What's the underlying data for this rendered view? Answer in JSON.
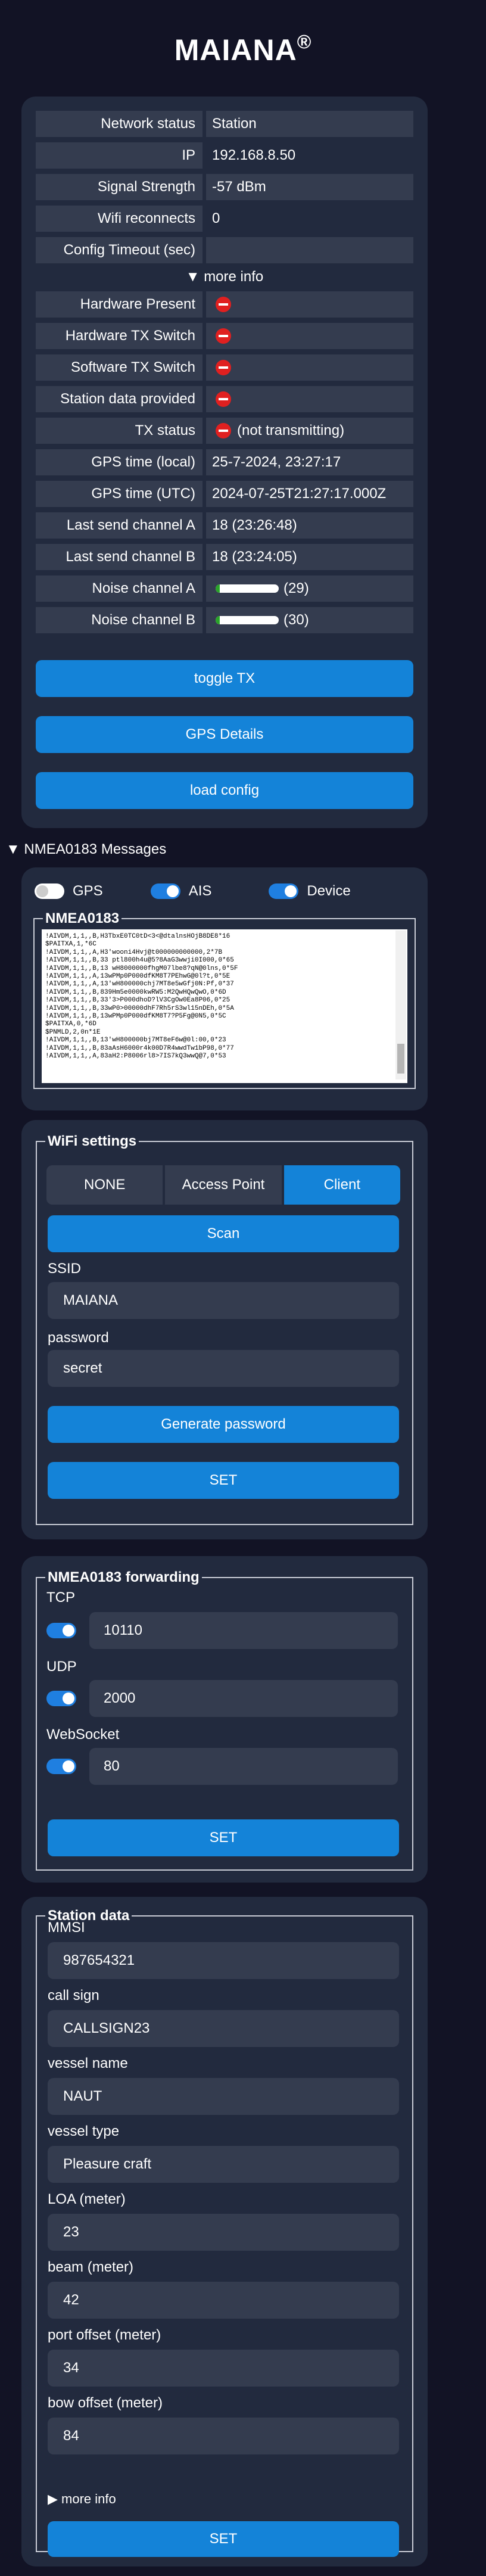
{
  "app": {
    "title": "MAIANA",
    "registered": "®"
  },
  "status": {
    "rows": [
      {
        "label": "Network status",
        "value": "Station",
        "type": "text"
      },
      {
        "label": "IP",
        "value": "192.168.8.50",
        "type": "text",
        "plain": true
      },
      {
        "label": "Signal Strength",
        "value": "-57 dBm",
        "type": "text"
      },
      {
        "label": "Wifi reconnects",
        "value": "0",
        "type": "text",
        "plain": true
      },
      {
        "label": "Config Timeout (sec)",
        "value": "",
        "type": "text"
      }
    ],
    "more_info": "▼ more info",
    "rows2": [
      {
        "label": "Hardware Present",
        "value": "",
        "type": "dot"
      },
      {
        "label": "Hardware TX Switch",
        "value": "",
        "type": "dot"
      },
      {
        "label": "Software TX Switch",
        "value": "",
        "type": "dot"
      },
      {
        "label": "Station data provided",
        "value": "",
        "type": "dot"
      },
      {
        "label": "TX status",
        "value": "(not transmitting)",
        "type": "dot"
      },
      {
        "label": "GPS time (local)",
        "value": "25-7-2024, 23:27:17",
        "type": "text"
      },
      {
        "label": "GPS time (UTC)",
        "value": "2024-07-25T21:27:17.000Z",
        "type": "text"
      },
      {
        "label": "Last send channel A",
        "value": "18 (23:26:48)",
        "type": "text"
      },
      {
        "label": "Last send channel B",
        "value": "18 (23:24:05)",
        "type": "text"
      },
      {
        "label": "Noise channel A",
        "value": "(29)",
        "type": "meter",
        "level": 0.07
      },
      {
        "label": "Noise channel B",
        "value": "(30)",
        "type": "meter",
        "level": 0.07
      }
    ],
    "buttons": {
      "toggle_tx": "toggle TX",
      "gps_details": "GPS Details",
      "load_config": "load config"
    }
  },
  "nmea": {
    "section_label": "▼ NMEA0183 Messages",
    "toggles": [
      {
        "label": "GPS",
        "on": false
      },
      {
        "label": "AIS",
        "on": true
      },
      {
        "label": "Device",
        "on": true
      }
    ],
    "legend": "NMEA0183",
    "lines": [
      "!AIVDM,1,1,,B,H3TbxE0TC0tD<3<@dtalnsHOjB8DE8*16",
      "$PAITXA,1,*6C",
      "!AIVDM,1,1,,A,H3'wooni4Hvj@t000000000000,2*7B",
      "!AIVDM,1,1,,B,33 ptl800h4u@5?8AaG3wwji0I000,0*65",
      "!AIVDM,1,1,,B,13 wH8000000fhgM07lbe8?qN@0lns,0*5F",
      "!AIVDM,1,1,,A,13wPMp0P000dfKM8T7PEhwG@0l?t,0*5E",
      "!AIVDM,1,1,,A,13'wH800000chj7MT8e5wGfj0N:Pf,0*37",
      "!AIVDM,1,1,,B,839Hm5e0000kwRW5:M2QwHQwQwO,0*6D",
      "!AIVDM,1,1,,B,33'3>P000dhoD?lV3CgOw0Ea8P06,0*25",
      "!AIVDM,1,1,,B,33wP0>00000dhF7Rh5rS3wl15nDEh,0*5A",
      "!AIVDM,1,1,,B,13wPMp0P000dfKM8T7?P5Fg@0N5,0*5C",
      "$PAITXA,0,*6D",
      "$PNMLD,2,0n*1E",
      "!AIVDM,1,1,,B,13'wH800000bj7MT8eF6w@0l:00,0*23",
      "!AIVDM,1,1,,B,83aAsH6000r4k00D7R4wwdTw1bP98,0*77",
      "!AIVDM,1,1,,A,83aH2:P8006rl8>7IS7kQ3wwQ@7,0*53"
    ]
  },
  "wifi": {
    "legend": "WiFi settings",
    "modes": [
      "NONE",
      "Access Point",
      "Client"
    ],
    "active_mode": "Client",
    "scan_label": "Scan",
    "ssid_label": "SSID",
    "ssid_value": "MAIANA",
    "password_label": "password",
    "password_value": "secret",
    "generate_label": "Generate password",
    "set_label": "SET"
  },
  "forwarding": {
    "legend": "NMEA0183 forwarding",
    "items": [
      {
        "label": "TCP",
        "on": true,
        "value": "10110"
      },
      {
        "label": "UDP",
        "on": true,
        "value": "2000"
      },
      {
        "label": "WebSocket",
        "on": true,
        "value": "80"
      }
    ],
    "set_label": "SET"
  },
  "station": {
    "legend": "Station data",
    "fields": [
      {
        "label": "MMSI",
        "value": "987654321"
      },
      {
        "label": "call sign",
        "value": "CALLSIGN23"
      },
      {
        "label": "vessel name",
        "value": "NAUT"
      },
      {
        "label": "vessel type",
        "value": "Pleasure craft"
      },
      {
        "label": "LOA (meter)",
        "value": "23"
      },
      {
        "label": "beam (meter)",
        "value": "42"
      },
      {
        "label": "port offset (meter)",
        "value": "34"
      },
      {
        "label": "bow offset (meter)",
        "value": "84"
      }
    ],
    "more_info": "▶ more info",
    "set_label": "SET"
  },
  "colors": {
    "accent": "#1483d8",
    "card": "#222a3e",
    "background": "#121325",
    "error": "#e02020",
    "meter": "#29a329"
  }
}
